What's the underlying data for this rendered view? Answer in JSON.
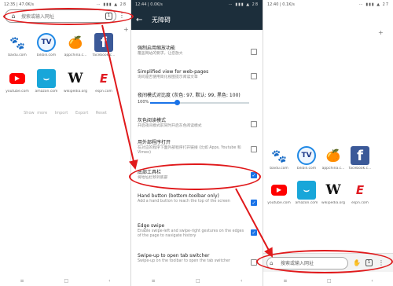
{
  "panel1": {
    "status_time": "12:35 | 47.0K/s",
    "status_icons": "⋯ ▮▮▮ ▲ 28",
    "address_placeholder": "搜索或输入网址",
    "tab_count": "1",
    "tiles": [
      {
        "icon": "baidu-icon",
        "glyph": "🐾",
        "label": "baidu.com"
      },
      {
        "icon": "bilibili-icon",
        "glyph": "TV",
        "label": "bilibili.com"
      },
      {
        "icon": "appchina-icon",
        "glyph": "🍊",
        "label": "appchina.c..."
      },
      {
        "icon": "facebook-icon",
        "glyph": "f",
        "label": "facebook.c..."
      },
      {
        "icon": "youtube-icon",
        "glyph": "▶",
        "label": "youtube.com"
      },
      {
        "icon": "amazon-icon",
        "glyph": "⌣",
        "label": "amazon.com"
      },
      {
        "icon": "wikipedia-icon",
        "glyph": "W",
        "label": "wikipedia.org"
      },
      {
        "icon": "espn-icon",
        "glyph": "E",
        "label": "espn.com"
      }
    ],
    "links": [
      "Show more",
      "Import",
      "Export",
      "Reset"
    ]
  },
  "panel2": {
    "status_time": "12:44 | 0.0K/s",
    "status_icons": "⋯ ▮▮▮ ▲ 28",
    "title": "无障碍",
    "settings": [
      {
        "title": "强制启用缩放功能",
        "sub": "覆盖网站的要求，让您放大",
        "checked": false
      },
      {
        "title": "Simplified view for web-pages",
        "sub": "询问是否使用简化视图提示阅读文章",
        "checked": false
      },
      {
        "title": "夜间模式对比度 (灰色: 97, 默认: 99, 黑色: 100)",
        "sub": "",
        "checked": null
      },
      {
        "title": "灰色阅读模式",
        "sub": "开启夜间模式前同时开启灰色阅读模式",
        "checked": false
      },
      {
        "title": "用外部程序打开",
        "sub": "在对应的程序下面外部程序打开链接 (比如 Apps, Youtube 和 Vimeo)",
        "checked": false
      },
      {
        "title": "底部工具栏",
        "sub": "将地址栏移到底部",
        "checked": true
      },
      {
        "title": "Hand button (bottom-toolbar only)",
        "sub": "Add a hand button to reach the top of the screen",
        "checked": true
      },
      {
        "title": "Edge swipe",
        "sub": "Enable swipe-left and swipe-right gestures on the edges of the page to navigate history",
        "checked": true
      },
      {
        "title": "Swipe-up to open tab switcher",
        "sub": "Swipe-up on the toolbar to open the tab switcher",
        "checked": false
      }
    ],
    "contrast_value": "100%",
    "contrast_level": 0.27
  },
  "panel3": {
    "status_time": "12:40 | 0.1K/s",
    "status_icons": "⋯ ▮▮▮ ▲ 27",
    "address_placeholder": "搜索或输入网址",
    "tab_count": "1"
  },
  "nav": {
    "menu": "≡",
    "home": "□",
    "back": "‹"
  },
  "colors": {
    "annotation": "#e0191b",
    "header": "#1c2e3b",
    "accent": "#1a73e8"
  }
}
